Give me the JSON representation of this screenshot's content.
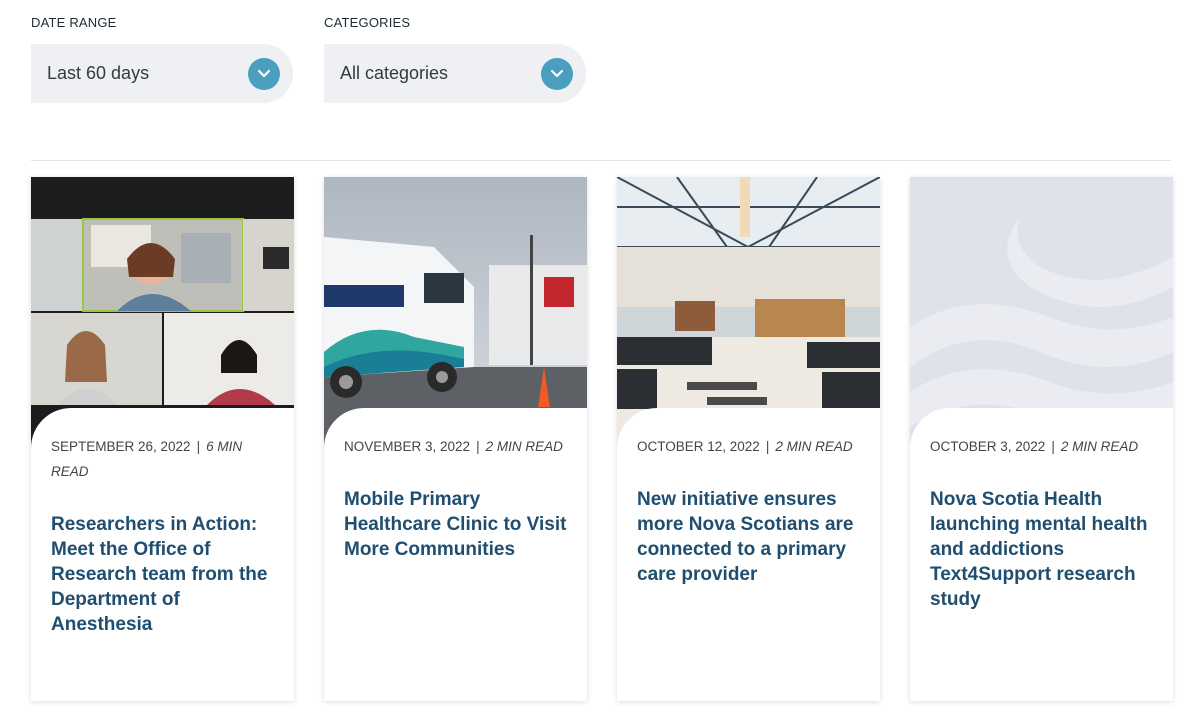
{
  "filters": {
    "date_range": {
      "label": "DATE RANGE",
      "value": "Last 60 days"
    },
    "categories": {
      "label": "CATEGORIES",
      "value": "All categories"
    }
  },
  "colors": {
    "accent": "#4a9fbf",
    "title": "#1f4e70",
    "select_bg": "#eef0f4"
  },
  "cards": [
    {
      "date": "SEPTEMBER 26, 2022",
      "read_time": "6 MIN READ",
      "title": "Researchers in Action: Meet the Office of Research team from the Department of Anesthesia",
      "image": "video-call-screenshot"
    },
    {
      "date": "NOVEMBER 3, 2022",
      "read_time": "2 MIN READ",
      "title": "Mobile Primary Healthcare Clinic to Visit More Communities",
      "image": "mobile-clinic-vans"
    },
    {
      "date": "OCTOBER 12, 2022",
      "read_time": "2 MIN READ",
      "title": "New initiative ensures more Nova Scotians are connected to a primary care provider",
      "image": "clinic-waiting-room"
    },
    {
      "date": "OCTOBER 3, 2022",
      "read_time": "2 MIN READ",
      "title": "Nova Scotia Health launching mental health and addictions Text4Support research study",
      "image": "wave-placeholder"
    }
  ]
}
